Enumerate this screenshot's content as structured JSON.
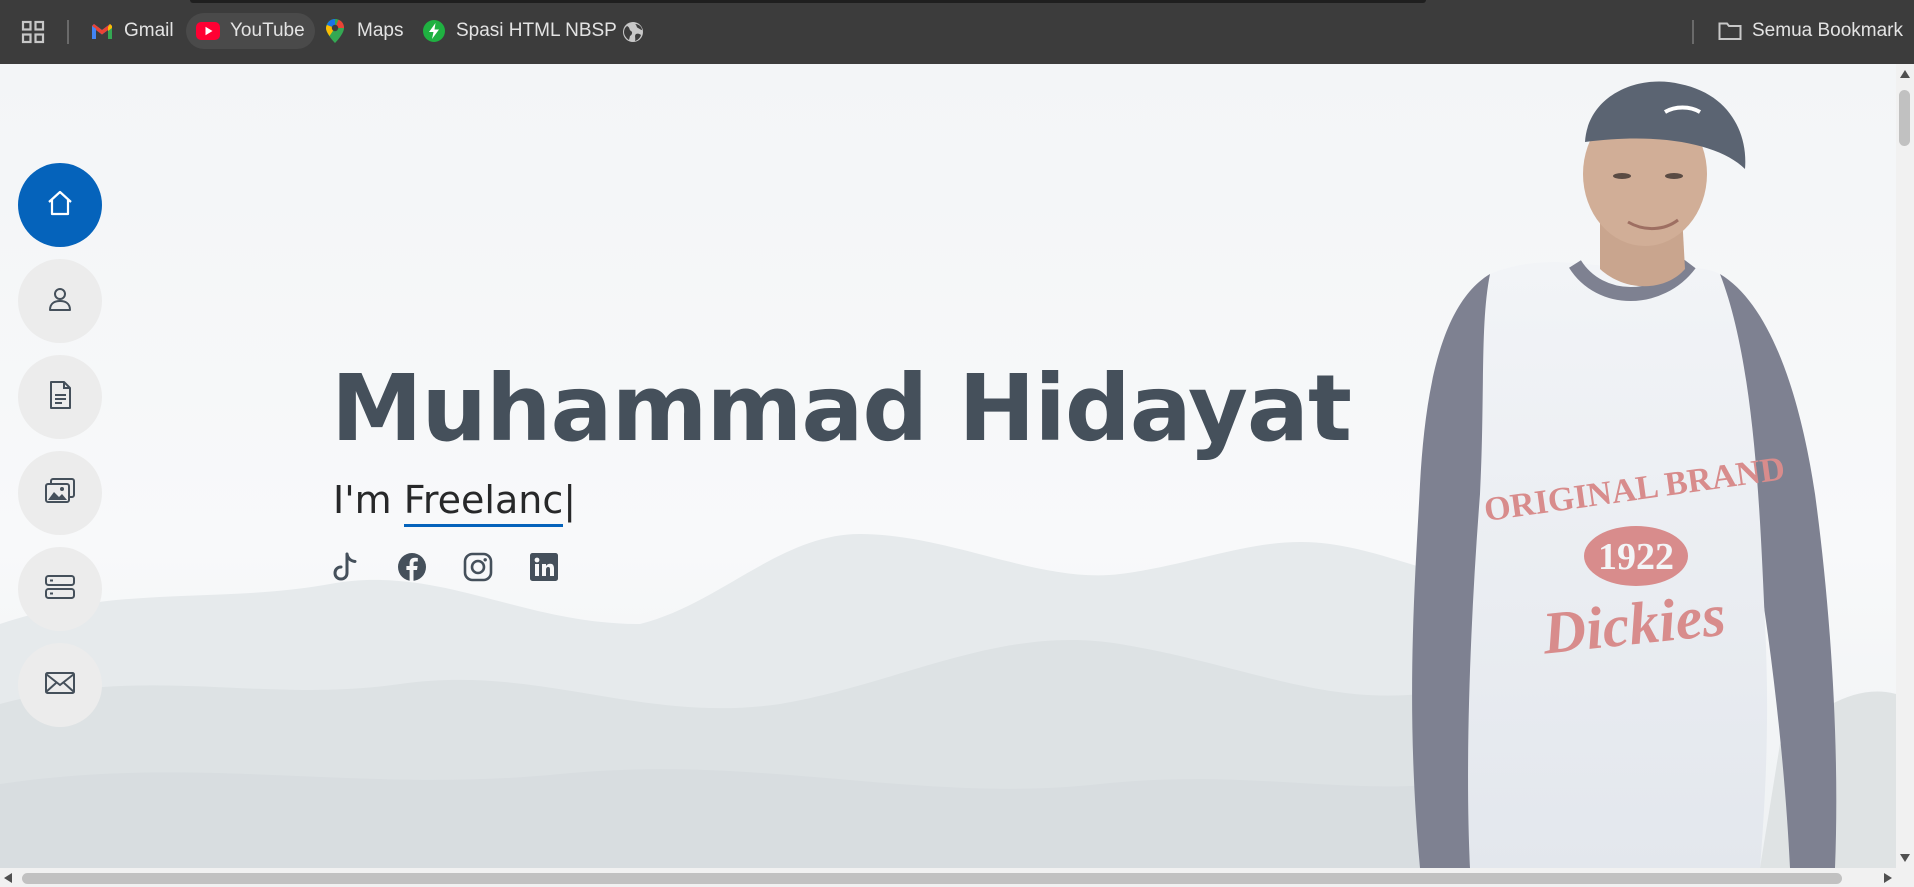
{
  "bookmarks": {
    "apps_icon": "apps-grid-icon",
    "items": [
      {
        "label": "Gmail",
        "icon": "gmail-icon"
      },
      {
        "label": "YouTube",
        "icon": "youtube-icon"
      },
      {
        "label": "Maps",
        "icon": "maps-pin-icon"
      },
      {
        "label": "Spasi HTML NBSP",
        "icon": "bolt-icon"
      }
    ],
    "globe_icon": "globe-icon",
    "all_bookmarks": {
      "label": "Semua Bookmark",
      "icon": "folder-icon"
    }
  },
  "nav": {
    "items": [
      {
        "name": "home",
        "icon": "home-icon",
        "active": true
      },
      {
        "name": "about",
        "icon": "person-icon",
        "active": false
      },
      {
        "name": "resume",
        "icon": "document-icon",
        "active": false
      },
      {
        "name": "portfolio",
        "icon": "images-icon",
        "active": false
      },
      {
        "name": "services",
        "icon": "server-icon",
        "active": false
      },
      {
        "name": "contact",
        "icon": "envelope-icon",
        "active": false
      }
    ]
  },
  "hero": {
    "name": "Muhammad Hidayat",
    "prefix": "I'm ",
    "typed": "Freelanc",
    "cursor": "|",
    "socials": [
      {
        "name": "tiktok",
        "icon": "tiktok-icon"
      },
      {
        "name": "facebook",
        "icon": "facebook-icon"
      },
      {
        "name": "instagram",
        "icon": "instagram-icon"
      },
      {
        "name": "linkedin",
        "icon": "linkedin-icon"
      }
    ],
    "shirt_text": {
      "line1": "ORIGINAL BRAND",
      "line2": "1922",
      "line3": "Dickies"
    }
  },
  "colors": {
    "accent": "#0563bb",
    "heading": "#45505b",
    "text": "#272829",
    "toolbar_bg": "#3c3c3c"
  }
}
